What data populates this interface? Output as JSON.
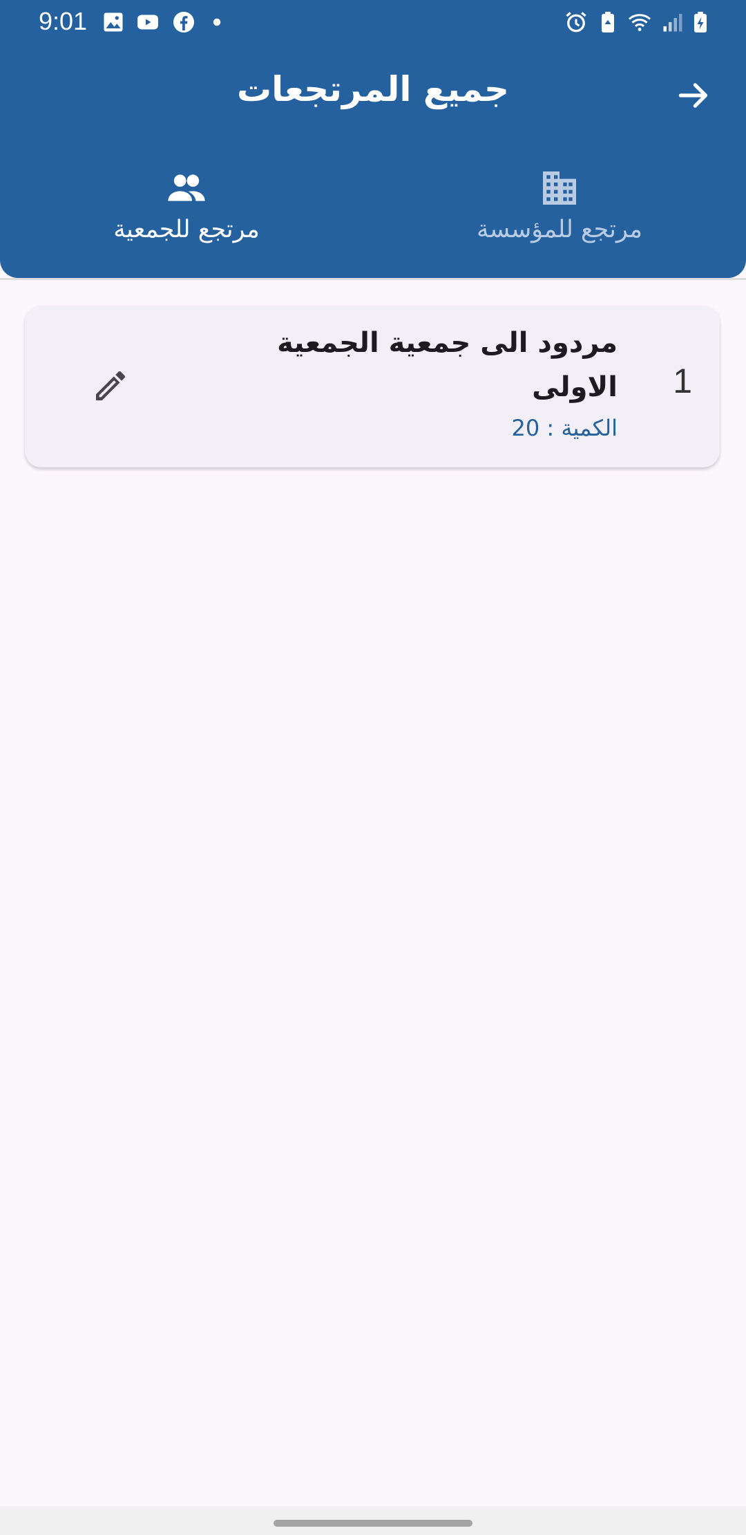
{
  "status_bar": {
    "time": "9:01",
    "left_icons": [
      "image-icon",
      "youtube-icon",
      "facebook-icon",
      "dot-icon"
    ],
    "right_icons": [
      "alarm-icon",
      "battery-saver-icon",
      "wifi-icon",
      "signal-icon",
      "battery-charging-icon"
    ]
  },
  "app_bar": {
    "title": "جميع المرتجعات",
    "back_icon": "arrow-forward-icon",
    "background_color": "#25609f"
  },
  "tabs": [
    {
      "label": "مرتجع للمؤسسة",
      "icon": "building-icon",
      "selected": false
    },
    {
      "label": "مرتجع للجمعية",
      "icon": "people-icon",
      "selected": true
    }
  ],
  "returns_list": [
    {
      "index": "1",
      "title": "مردود الى جمعية الجمعية الاولى",
      "quantity": "الكمية : 20",
      "action_icon": "pencil-edit-icon"
    }
  ],
  "colors": {
    "primary": "#25609f",
    "background": "#fcf6fd",
    "card": "#f3eff6",
    "tab_inactive": "#b9cce4"
  }
}
